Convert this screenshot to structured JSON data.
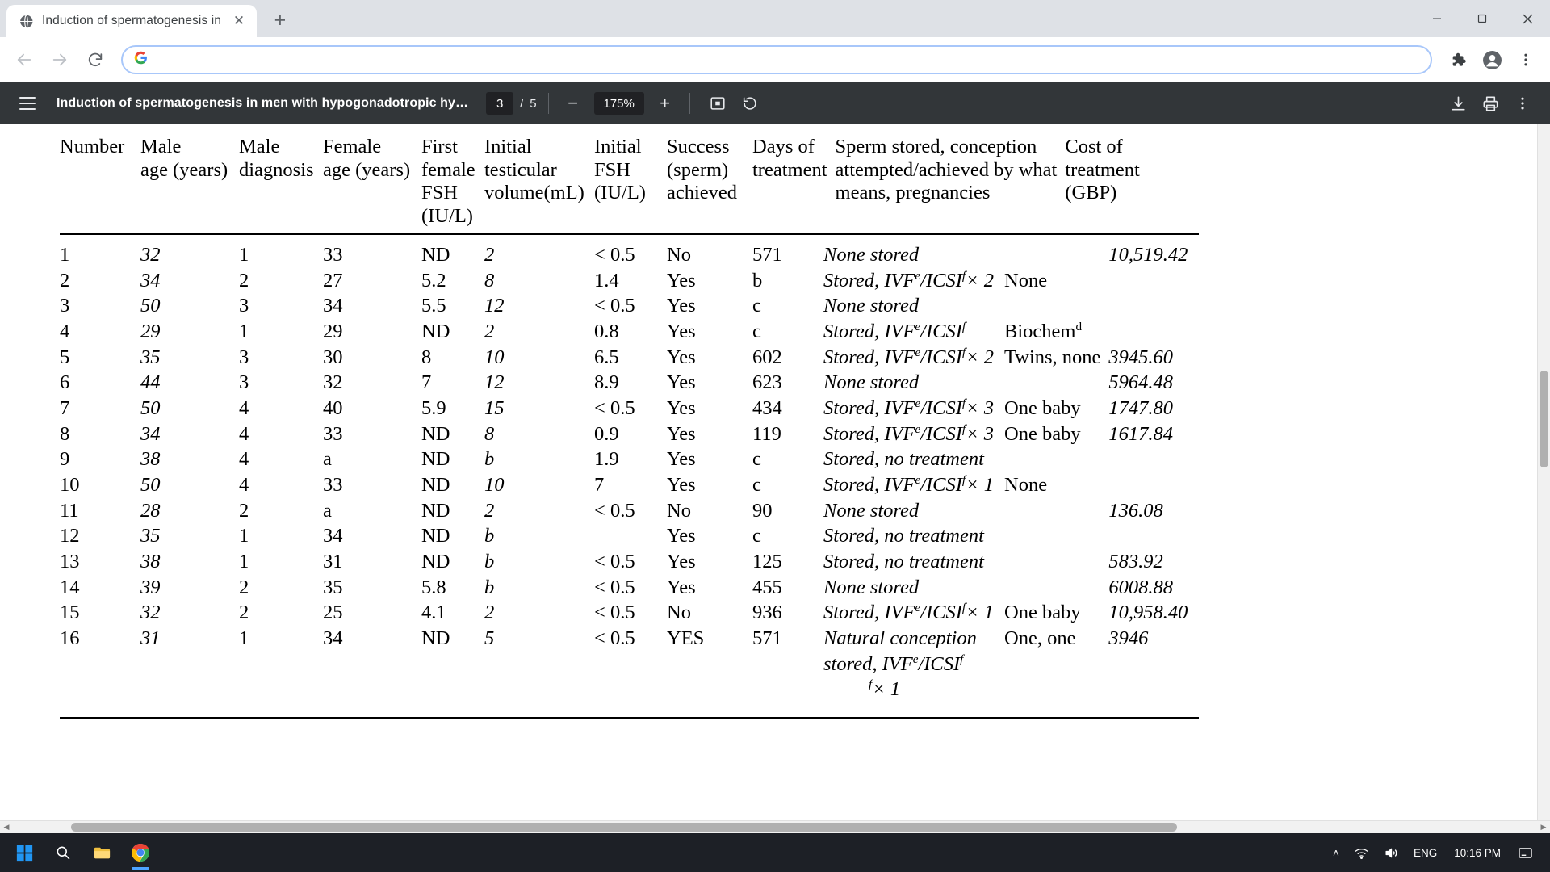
{
  "browser": {
    "tab": {
      "title": "Induction of spermatogenesis in",
      "favicon": "globe-icon",
      "close_label": "✕"
    },
    "newtab_label": "+",
    "window_controls": {
      "minimize": "—",
      "maximize": "❐",
      "close": "✕"
    },
    "nav": {
      "back": "←",
      "forward": "→",
      "reload": "↻"
    },
    "omnibox": {
      "value": "",
      "placeholder": "",
      "icon": "google-g-icon"
    },
    "toolbar_icons": {
      "extensions": "puzzle-piece-icon",
      "profile": "account-avatar-icon",
      "menu": "three-dot-menu-icon"
    }
  },
  "pdf_viewer": {
    "menu_label": "sidebar-menu-icon",
    "document_title": "Induction of spermatogenesis in men with hypogonadotropic hy…",
    "current_page": "3",
    "page_separator": "/",
    "total_pages": "5",
    "zoom_out_label": "−",
    "zoom_level": "175%",
    "zoom_in_label": "+",
    "fit_label": "fit-to-page-icon",
    "rotate_label": "rotate-icon",
    "download_label": "download-icon",
    "print_label": "print-icon",
    "more_label": "more-options-icon"
  },
  "document": {
    "table": {
      "headers": [
        "Number",
        "Male age (years)",
        "Male diagnosis",
        "Female age (years)",
        "First female FSH (IU/L)",
        "Initial testicular volume(mL)",
        "Initial FSH (IU/L)",
        "Success (sperm) achieved",
        "Days of treatment",
        "Sperm stored, conception attempted/achieved by what means, pregnancies",
        "Cost of treatment (GBP)"
      ],
      "header_lines": {
        "number": [
          "Number"
        ],
        "male_age": [
          "Male",
          "age (years)"
        ],
        "male_diagnosis": [
          "Male",
          "diagnosis"
        ],
        "female_age": [
          "Female",
          "age (years)"
        ],
        "first_female_fsh": [
          "First",
          "female",
          "FSH",
          "(IU/L)"
        ],
        "initial_testicular_volume": [
          "Initial",
          "testicular",
          "volume(mL)"
        ],
        "initial_fsh": [
          "Initial",
          "FSH",
          "(IU/L)"
        ],
        "success": [
          "Success",
          "(sperm)",
          "achieved"
        ],
        "days": [
          "Days of",
          "treatment"
        ],
        "sperm_stored": [
          "Sperm stored, conception",
          "attempted/achieved by what",
          "means, pregnancies"
        ],
        "cost": [
          "Cost of",
          "treatment",
          "(GBP)"
        ]
      },
      "rows": [
        {
          "number": "1",
          "male_age": "32",
          "male_diagnosis": "1",
          "female_age": "33",
          "first_female_fsh": "ND",
          "initial_testicular_volume": "2",
          "initial_fsh": "< 0.5",
          "success": "No",
          "days": "571",
          "sperm_stored": "None stored",
          "sperm_sup": "",
          "pregnancies": "",
          "cost": "10,519.42"
        },
        {
          "number": "2",
          "male_age": "34",
          "male_diagnosis": "2",
          "female_age": "27",
          "first_female_fsh": "5.2",
          "initial_testicular_volume": "8",
          "initial_fsh": "1.4",
          "success": "Yes",
          "days": "b",
          "sperm_stored": "Stored, IVF/ICSI× 2",
          "sperm_sup": "ef",
          "pregnancies": "None",
          "cost": ""
        },
        {
          "number": "3",
          "male_age": "50",
          "male_diagnosis": "3",
          "female_age": "34",
          "first_female_fsh": "5.5",
          "initial_testicular_volume": "12",
          "initial_fsh": "< 0.5",
          "success": "Yes",
          "days": "c",
          "sperm_stored": "None stored",
          "sperm_sup": "",
          "pregnancies": "",
          "cost": ""
        },
        {
          "number": "4",
          "male_age": "29",
          "male_diagnosis": "1",
          "female_age": "29",
          "first_female_fsh": "ND",
          "initial_testicular_volume": "2",
          "initial_fsh": "0.8",
          "success": "Yes",
          "days": "c",
          "sperm_stored": "Stored, IVF/ICSI",
          "sperm_sup": "ef",
          "pregnancies": "Biochem",
          "preg_sup": "d",
          "cost": ""
        },
        {
          "number": "5",
          "male_age": "35",
          "male_diagnosis": "3",
          "female_age": "30",
          "first_female_fsh": "8",
          "initial_testicular_volume": "10",
          "initial_fsh": "6.5",
          "success": "Yes",
          "days": "602",
          "sperm_stored": "Stored, IVF/ICSI× 2",
          "sperm_sup": "ef",
          "pregnancies": "Twins, none",
          "cost": "3945.60"
        },
        {
          "number": "6",
          "male_age": "44",
          "male_diagnosis": "3",
          "female_age": "32",
          "first_female_fsh": "7",
          "initial_testicular_volume": "12",
          "initial_fsh": "8.9",
          "success": "Yes",
          "days": "623",
          "sperm_stored": "None stored",
          "sperm_sup": "",
          "pregnancies": "",
          "cost": "5964.48"
        },
        {
          "number": "7",
          "male_age": "50",
          "male_diagnosis": "4",
          "female_age": "40",
          "first_female_fsh": "5.9",
          "initial_testicular_volume": "15",
          "initial_fsh": "< 0.5",
          "success": "Yes",
          "days": "434",
          "sperm_stored": "Stored, IVF/ICSI× 3",
          "sperm_sup": "ef",
          "pregnancies": "One baby",
          "cost": "1747.80"
        },
        {
          "number": "8",
          "male_age": "34",
          "male_diagnosis": "4",
          "female_age": "33",
          "first_female_fsh": "ND",
          "initial_testicular_volume": "8",
          "initial_fsh": "0.9",
          "success": "Yes",
          "days": "119",
          "sperm_stored": "Stored, IVF/ICSI× 3",
          "sperm_sup": "ef",
          "pregnancies": "One baby",
          "cost": "1617.84"
        },
        {
          "number": "9",
          "male_age": "38",
          "male_diagnosis": "4",
          "female_age": "a",
          "first_female_fsh": "ND",
          "initial_testicular_volume": "b",
          "initial_fsh": "1.9",
          "success": "Yes",
          "days": "c",
          "sperm_stored": "Stored, no treatment",
          "sperm_sup": "",
          "pregnancies": "",
          "cost": ""
        },
        {
          "number": "10",
          "male_age": "50",
          "male_diagnosis": "4",
          "female_age": "33",
          "first_female_fsh": "ND",
          "initial_testicular_volume": "10",
          "initial_fsh": "7",
          "success": "Yes",
          "days": "c",
          "sperm_stored": "Stored, IVF/ICSI× 1",
          "sperm_sup": "ef",
          "pregnancies": "None",
          "cost": ""
        },
        {
          "number": "11",
          "male_age": "28",
          "male_diagnosis": "2",
          "female_age": "a",
          "first_female_fsh": "ND",
          "initial_testicular_volume": "2",
          "initial_fsh": "< 0.5",
          "success": "No",
          "days": "90",
          "sperm_stored": "None stored",
          "sperm_sup": "",
          "pregnancies": "",
          "cost": "136.08"
        },
        {
          "number": "12",
          "male_age": "35",
          "male_diagnosis": "1",
          "female_age": "34",
          "first_female_fsh": "ND",
          "initial_testicular_volume": "b",
          "initial_fsh": "",
          "success": "Yes",
          "days": "c",
          "sperm_stored": "Stored, no treatment",
          "sperm_sup": "",
          "pregnancies": "",
          "cost": ""
        },
        {
          "number": "13",
          "male_age": "38",
          "male_diagnosis": "1",
          "female_age": "31",
          "first_female_fsh": "ND",
          "initial_testicular_volume": "b",
          "initial_fsh": "< 0.5",
          "success": "Yes",
          "days": "125",
          "sperm_stored": "Stored, no treatment",
          "sperm_sup": "",
          "pregnancies": "",
          "cost": "583.92"
        },
        {
          "number": "14",
          "male_age": "39",
          "male_diagnosis": "2",
          "female_age": "35",
          "first_female_fsh": "5.8",
          "initial_testicular_volume": "b",
          "initial_fsh": "< 0.5",
          "success": "Yes",
          "days": "455",
          "sperm_stored": "None stored",
          "sperm_sup": "",
          "pregnancies": "",
          "cost": "6008.88"
        },
        {
          "number": "15",
          "male_age": "32",
          "male_diagnosis": "2",
          "female_age": "25",
          "first_female_fsh": "4.1",
          "initial_testicular_volume": "2",
          "initial_fsh": "< 0.5",
          "success": "No",
          "days": "936",
          "sperm_stored": "Stored, IVF/ICSI× 1",
          "sperm_sup": "ef",
          "pregnancies": "One baby",
          "cost": "10,958.40"
        },
        {
          "number": "16",
          "male_age": "31",
          "male_diagnosis": "1",
          "female_age": "34",
          "first_female_fsh": "ND",
          "initial_testicular_volume": "5",
          "initial_fsh": "< 0.5",
          "success": "YES",
          "days": "571",
          "sperm_stored": "Natural conception",
          "sperm_sup": "",
          "pregnancies": "One, one",
          "cost": "3946"
        }
      ],
      "row16_extra_line1": "stored, IVF/ICSI",
      "row16_extra_line2": "× 1"
    }
  },
  "taskbar": {
    "start": "windows-start-icon",
    "search": "search-icon",
    "apps": [
      {
        "name": "file-explorer-icon"
      },
      {
        "name": "chrome-icon"
      }
    ],
    "tray": {
      "chevron": "˄",
      "network": "wifi-icon",
      "volume": "speaker-icon",
      "language": "ENG",
      "time": "10:16 PM",
      "notifications": "notification-icon"
    }
  }
}
